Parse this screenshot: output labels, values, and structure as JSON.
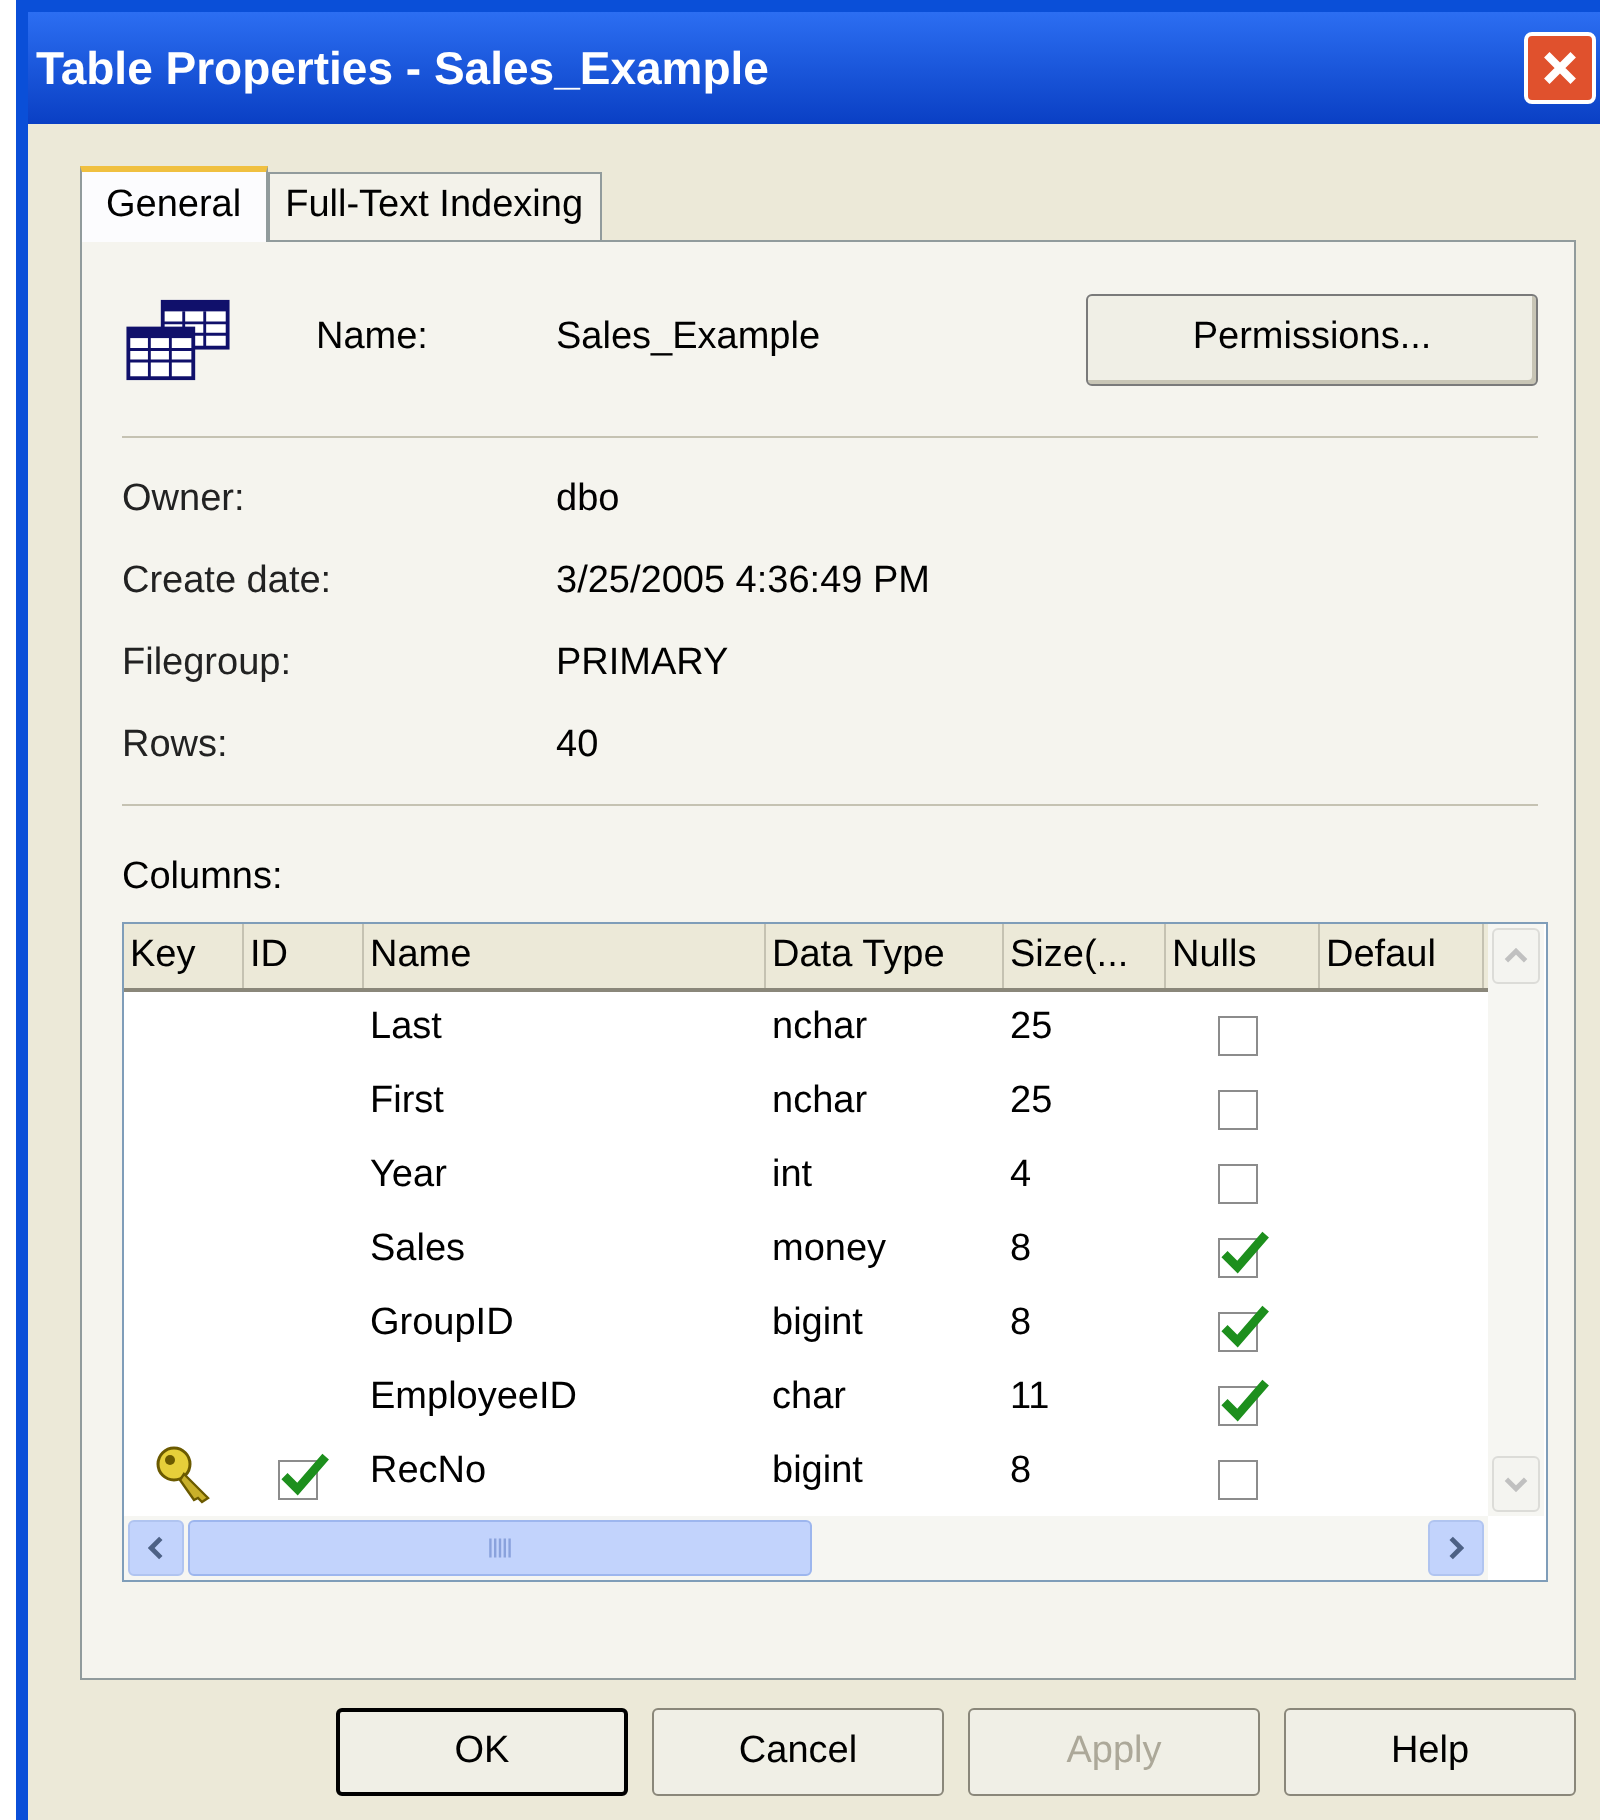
{
  "window": {
    "title": "Table Properties - Sales_Example"
  },
  "tabs": [
    {
      "label": "General",
      "selected": true
    },
    {
      "label": "Full-Text Indexing",
      "selected": false
    }
  ],
  "name": {
    "label": "Name:",
    "value": "Sales_Example",
    "button": "Permissions..."
  },
  "properties": [
    {
      "label": "Owner:",
      "value": "dbo"
    },
    {
      "label": "Create date:",
      "value": "3/25/2005 4:36:49 PM"
    },
    {
      "label": "Filegroup:",
      "value": "PRIMARY"
    },
    {
      "label": "Rows:",
      "value": "40"
    }
  ],
  "columns_label": "Columns:",
  "table": {
    "columns": [
      "Key",
      "ID",
      "Name",
      "Data Type",
      "Size(...",
      "Nulls",
      "Defaul"
    ],
    "rows": [
      {
        "key": false,
        "identity": false,
        "name": "Last",
        "data_type": "nchar",
        "size": "25",
        "nulls": false
      },
      {
        "key": false,
        "identity": false,
        "name": "First",
        "data_type": "nchar",
        "size": "25",
        "nulls": false
      },
      {
        "key": false,
        "identity": false,
        "name": "Year",
        "data_type": "int",
        "size": "4",
        "nulls": false
      },
      {
        "key": false,
        "identity": false,
        "name": "Sales",
        "data_type": "money",
        "size": "8",
        "nulls": true
      },
      {
        "key": false,
        "identity": false,
        "name": "GroupID",
        "data_type": "bigint",
        "size": "8",
        "nulls": true
      },
      {
        "key": false,
        "identity": false,
        "name": "EmployeeID",
        "data_type": "char",
        "size": "11",
        "nulls": true
      },
      {
        "key": true,
        "identity": true,
        "name": "RecNo",
        "data_type": "bigint",
        "size": "8",
        "nulls": false
      }
    ]
  },
  "buttons": [
    {
      "label": "OK",
      "default": true,
      "disabled": false
    },
    {
      "label": "Cancel",
      "default": false,
      "disabled": false
    },
    {
      "label": "Apply",
      "default": false,
      "disabled": true
    },
    {
      "label": "Help",
      "default": false,
      "disabled": false
    }
  ]
}
